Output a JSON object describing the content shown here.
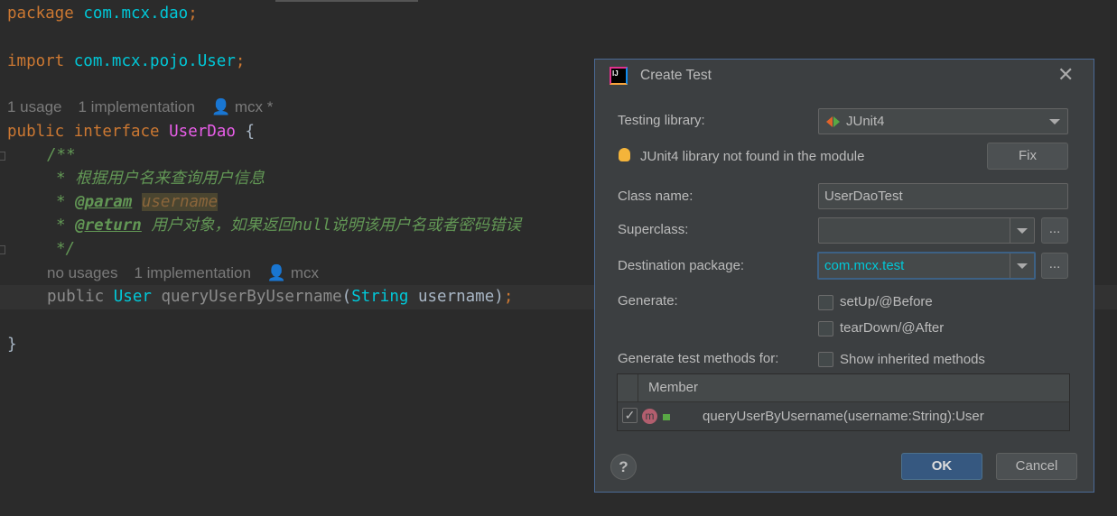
{
  "editor": {
    "line1": {
      "kw": "package",
      "pkg": "com.mcx.dao",
      "semi": ";"
    },
    "line2": {
      "kw": "import",
      "pkg": "com.mcx.pojo.User",
      "semi": ";"
    },
    "lens1": {
      "usages": "1 usage",
      "impl": "1 implementation",
      "author": "mcx *"
    },
    "line3": {
      "kw1": "public",
      "kw2": "interface",
      "name": "UserDao",
      "brace": "{"
    },
    "doc": {
      "open": "/**",
      "desc": "* 根据用户名来查询用户信息",
      "param_star": "* ",
      "param_tag": "@param",
      "param_name": "username",
      "return_star": "* ",
      "return_tag": "@return",
      "return_desc": " 用户对象，如果返回null说明该用户名或者密码错误",
      "close": "*/"
    },
    "lens2": {
      "usages": "no usages",
      "impl": "1 implementation",
      "author": "mcx"
    },
    "method": {
      "kw": "public",
      "type": "User",
      "name": "queryUserByUsername",
      "paren": "(",
      "ptype": "String",
      "pname": "username",
      "end": ")",
      "semi": ";"
    },
    "close": "}"
  },
  "dialog": {
    "title": "Create Test",
    "testing_library_label": "Testing library:",
    "testing_library_value": "JUnit4",
    "warning": "JUnit4 library not found in the module",
    "fix": "Fix",
    "class_name_label": "Class name:",
    "class_name_value": "UserDaoTest",
    "superclass_label": "Superclass:",
    "superclass_value": "",
    "browse": "...",
    "dest_label": "Destination package:",
    "dest_value": "com.mcx.test",
    "generate_label": "Generate:",
    "setup": "setUp/@Before",
    "teardown": "tearDown/@After",
    "methods_label": "Generate test methods for:",
    "inherited": "Show inherited methods",
    "table": {
      "header": "Member",
      "rows": [
        {
          "checked": true,
          "signature": "queryUserByUsername(username:String):User"
        }
      ]
    },
    "help": "?",
    "ok": "OK",
    "cancel": "Cancel"
  }
}
